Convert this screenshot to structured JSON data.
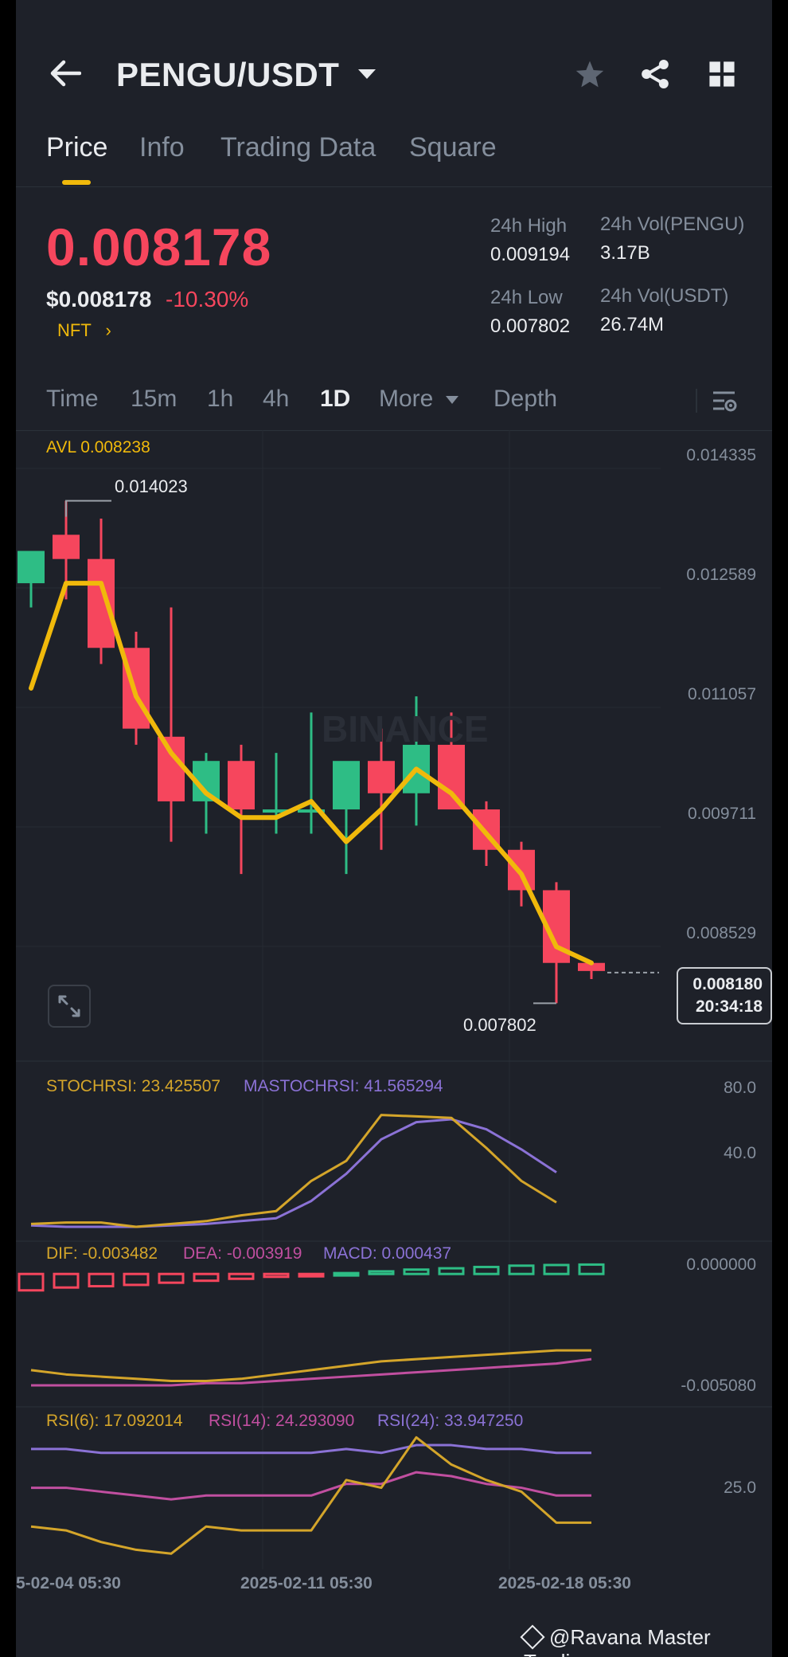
{
  "header": {
    "title": "PENGU/USDT",
    "icons": [
      "arrow-left-icon",
      "caret-down-icon",
      "star-icon",
      "share-icon",
      "grid-icon"
    ]
  },
  "tabs": [
    {
      "label": "Price",
      "active": true
    },
    {
      "label": "Info",
      "active": false
    },
    {
      "label": "Trading Data",
      "active": false
    },
    {
      "label": "Square",
      "active": false
    }
  ],
  "price": {
    "last": "0.008178",
    "usd": "$0.008178",
    "change": "-10.30%",
    "tag": "NFT",
    "tag_arrow": "›"
  },
  "stats": {
    "high_label": "24h High",
    "high_value": "0.009194",
    "low_label": "24h Low",
    "low_value": "0.007802",
    "vol_pengu_label": "24h Vol(PENGU)",
    "vol_pengu_value": "3.17B",
    "vol_usdt_label": "24h Vol(USDT)",
    "vol_usdt_value": "26.74M"
  },
  "intervals": {
    "time": "Time",
    "m15": "15m",
    "h1": "1h",
    "h4": "4h",
    "d1": "1D",
    "more": "More",
    "depth": "Depth",
    "active": "1D"
  },
  "chart_data": {
    "type": "candlestick",
    "timeframe": "1D",
    "avl_label": "AVL 0.008238",
    "watermark": "BINANCE",
    "price_axis": [
      "0.014335",
      "0.012589",
      "0.011057",
      "0.009711",
      "0.008529"
    ],
    "ylim": [
      0.0074,
      0.0145
    ],
    "x_axis_labels": [
      "5-02-04 05:30",
      "2025-02-11 05:30",
      "2025-02-18 05:30"
    ],
    "max_marker": "0.014023",
    "min_marker": "0.007802",
    "last_price_tag": "0.008180",
    "countdown": "20:34:18",
    "candles": [
      {
        "o": 0.013,
        "h": 0.0133,
        "l": 0.0127,
        "c": 0.0134
      },
      {
        "o": 0.0136,
        "h": 0.01402,
        "l": 0.0128,
        "c": 0.0133
      },
      {
        "o": 0.0133,
        "h": 0.0138,
        "l": 0.012,
        "c": 0.0122
      },
      {
        "o": 0.0122,
        "h": 0.0124,
        "l": 0.011,
        "c": 0.0112
      },
      {
        "o": 0.0111,
        "h": 0.0127,
        "l": 0.0098,
        "c": 0.0103
      },
      {
        "o": 0.0103,
        "h": 0.0109,
        "l": 0.0099,
        "c": 0.0108
      },
      {
        "o": 0.0108,
        "h": 0.011,
        "l": 0.0094,
        "c": 0.0102
      },
      {
        "o": 0.0102,
        "h": 0.0109,
        "l": 0.0099,
        "c": 0.0102
      },
      {
        "o": 0.0102,
        "h": 0.0114,
        "l": 0.0099,
        "c": 0.0102
      },
      {
        "o": 0.0102,
        "h": 0.0107,
        "l": 0.0094,
        "c": 0.0108
      },
      {
        "o": 0.0108,
        "h": 0.0112,
        "l": 0.0097,
        "c": 0.0104
      },
      {
        "o": 0.0104,
        "h": 0.0116,
        "l": 0.01,
        "c": 0.011
      },
      {
        "o": 0.011,
        "h": 0.0114,
        "l": 0.0102,
        "c": 0.0102
      },
      {
        "o": 0.0102,
        "h": 0.0103,
        "l": 0.0095,
        "c": 0.0097
      },
      {
        "o": 0.0097,
        "h": 0.0098,
        "l": 0.009,
        "c": 0.0092
      },
      {
        "o": 0.0092,
        "h": 0.0093,
        "l": 0.0078,
        "c": 0.0083
      },
      {
        "o": 0.0083,
        "h": 0.0083,
        "l": 0.0081,
        "c": 0.0082
      }
    ],
    "avl_line": [
      0.0117,
      0.013,
      0.013,
      0.0116,
      0.0109,
      0.0104,
      0.0101,
      0.0101,
      0.0103,
      0.0098,
      0.0102,
      0.0107,
      0.0104,
      0.0099,
      0.0094,
      0.0085,
      0.0083
    ],
    "stochrsi": {
      "label": "STOCHRSI: 23.425507",
      "ma_label": "MASTOCHRSI: 41.565294",
      "axis": [
        "80.0",
        "40.0"
      ],
      "ylim": [
        0,
        100
      ],
      "stoch": [
        2,
        3,
        3,
        0,
        2,
        4,
        8,
        11,
        32,
        46,
        78,
        77,
        76,
        55,
        32,
        17
      ],
      "ma": [
        1,
        0,
        0,
        0,
        1,
        2,
        4,
        6,
        18,
        37,
        61,
        73,
        75,
        68,
        54,
        38
      ]
    },
    "macd": {
      "dif_label": "DIF: -0.003482",
      "dea_label": "DEA: -0.003919",
      "macd_label": "MACD: 0.000437",
      "axis": [
        "0.000000",
        "-0.005080"
      ],
      "ylim": [
        -0.0055,
        0.0007
      ],
      "hist": [
        -0.00075,
        -0.00062,
        -0.00056,
        -0.0005,
        -0.0004,
        -0.00031,
        -0.00022,
        -0.00013,
        -5e-05,
        4e-05,
        0.00012,
        0.0002,
        0.00026,
        0.00032,
        0.00038,
        0.00041,
        0.00043
      ],
      "dif": [
        -0.0044,
        -0.0046,
        -0.0047,
        -0.0048,
        -0.0049,
        -0.0049,
        -0.0048,
        -0.0046,
        -0.0044,
        -0.0042,
        -0.004,
        -0.0039,
        -0.0038,
        -0.0037,
        -0.0036,
        -0.0035,
        -0.0035
      ],
      "dea": [
        -0.0051,
        -0.0051,
        -0.0051,
        -0.0051,
        -0.0051,
        -0.005,
        -0.005,
        -0.0049,
        -0.0048,
        -0.0047,
        -0.0046,
        -0.0045,
        -0.0044,
        -0.0043,
        -0.0042,
        -0.0041,
        -0.0039
      ]
    },
    "rsi": {
      "rsi6_label": "RSI(6): 17.092014",
      "rsi14_label": "RSI(14): 24.293090",
      "rsi24_label": "RSI(24): 33.947250",
      "axis": [
        "25.0"
      ],
      "ylim": [
        5,
        42
      ],
      "rsi6": [
        14,
        13,
        10,
        8,
        7,
        14,
        13,
        13,
        13,
        26,
        24,
        37,
        30,
        26,
        23,
        15,
        15
      ],
      "rsi14": [
        24,
        24,
        23,
        22,
        21,
        22,
        22,
        22,
        22,
        25,
        25,
        28,
        27,
        25,
        24,
        22,
        22
      ],
      "rsi24": [
        34,
        34,
        33,
        33,
        33,
        33,
        33,
        33,
        33,
        34,
        33,
        35,
        35,
        34,
        34,
        33,
        33
      ]
    }
  },
  "colors": {
    "up": "#2ebd85",
    "down": "#f6465d",
    "avl": "#f0b90b",
    "stoch": "#d4a52a",
    "mastoch": "#8b72d6",
    "dif": "#d4a52a",
    "dea": "#c14fa0",
    "rsi6": "#d4a52a",
    "rsi14": "#c14fa0",
    "rsi24": "#8b72d6"
  },
  "footer": {
    "credit": "@Ravana Master Tradin..."
  }
}
